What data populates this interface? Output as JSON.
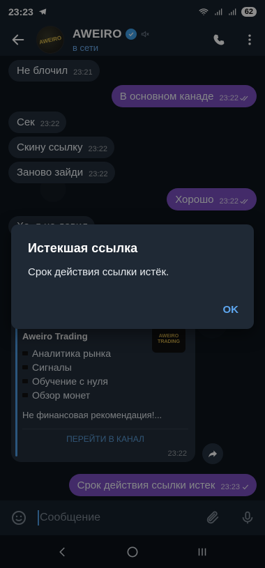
{
  "statusbar": {
    "time": "23:23",
    "battery": "62"
  },
  "header": {
    "title": "AWEIRO",
    "status": "в сети",
    "avatar_text": "AWEIRO"
  },
  "messages": [
    {
      "dir": "in",
      "text": "Не блочил",
      "time": "23:21"
    },
    {
      "dir": "out",
      "text": "В основном канаде",
      "time": "23:22",
      "read": true
    },
    {
      "dir": "in",
      "text": "Сек",
      "time": "23:22"
    },
    {
      "dir": "in",
      "text": "Скину ссылку",
      "time": "23:22"
    },
    {
      "dir": "in",
      "text": "Заново зайди",
      "time": "23:22"
    },
    {
      "dir": "out",
      "text": "Хорошо",
      "time": "23:22",
      "read": true
    },
    {
      "dir": "in",
      "text": "Ха, я не давил",
      "time": ""
    },
    {
      "dir": "out",
      "text": "Срок действия ссылки истек",
      "time": "23:23",
      "read": false
    }
  ],
  "card": {
    "brand": "Aweiro Trading",
    "thumb_line1": "AWEIRO",
    "thumb_line2": "TRADING",
    "items": [
      "Аналитика рынка",
      "Сигналы",
      "Обучение с нуля",
      "Обзор монет"
    ],
    "disclaimer": "Не финансовая рекомендация!...",
    "button": "ПЕРЕЙТИ В КАНАЛ",
    "time": "23:22"
  },
  "dialog": {
    "title": "Истекшая ссылка",
    "text": "Срок действия ссылки истёк.",
    "ok": "OK"
  },
  "composer": {
    "placeholder": "Сообщение"
  },
  "colors": {
    "accent": "#5ea7f0",
    "outgoing": "#7b4fbf",
    "incoming": "#232f3b"
  }
}
